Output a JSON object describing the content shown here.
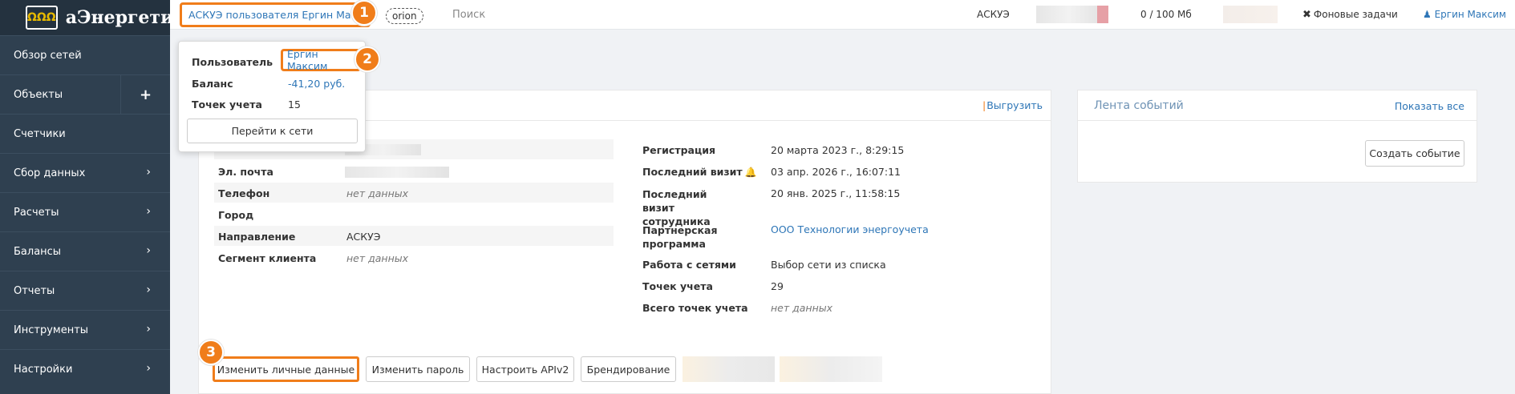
{
  "app": {
    "logo_mark": "ΩΩΩ",
    "logo_text": "аЭнергетик"
  },
  "sidebar": {
    "items": [
      {
        "label": "Обзор сетей",
        "icon": ""
      },
      {
        "label": "Объекты",
        "icon": "plus-icon"
      },
      {
        "label": "Счетчики",
        "icon": ""
      },
      {
        "label": "Сбор данных",
        "icon": "chevron-right-icon"
      },
      {
        "label": "Расчеты",
        "icon": "chevron-right-icon"
      },
      {
        "label": "Балансы",
        "icon": "chevron-right-icon"
      },
      {
        "label": "Отчеты",
        "icon": "chevron-right-icon"
      },
      {
        "label": "Инструменты",
        "icon": "chevron-right-icon"
      },
      {
        "label": "Настройки",
        "icon": "chevron-right-icon"
      }
    ]
  },
  "topbar": {
    "title": "АСКУЭ пользователя Ергин Максим",
    "org": "orion",
    "search": "Поиск",
    "system": "АСКУЭ",
    "storage": "0 / 100 Мб",
    "tasks": "Фоновые задачи",
    "user": "Ергин Максим"
  },
  "popup": {
    "user_label": "Пользователь",
    "user_value": "Ергин Максим",
    "balance_label": "Баланс",
    "balance_value": "-41,20 руб.",
    "points_label": "Точек учета",
    "points_value": "15",
    "go_button": "Перейти к сети"
  },
  "badges": [
    "1",
    "2",
    "3"
  ],
  "profile": {
    "export": "Выгрузить",
    "left_fields": [
      {
        "label": "Эл. почта",
        "value": ""
      },
      {
        "label": "Телефон",
        "value": "нет данных"
      },
      {
        "label": "Город",
        "value": ""
      },
      {
        "label": "Направление",
        "value": "АСКУЭ"
      },
      {
        "label": "Сегмент клиента",
        "value": "нет данных"
      }
    ],
    "right_fields": [
      {
        "label": "Регистрация",
        "value": "20 марта 2023 г., 8:29:15"
      },
      {
        "label": "Последний визит",
        "value": "03 апр. 2026 г., 16:07:11"
      },
      {
        "label": "Последний визит сотрудника",
        "value": "20 янв. 2025 г., 11:58:15"
      },
      {
        "label": "Партнерская программа",
        "value": "ООО Технологии энергоучета"
      },
      {
        "label": "Работа с сетями",
        "value": "Выбор сети из списка"
      },
      {
        "label": "Точек учета",
        "value": "29"
      },
      {
        "label": "Всего точек учета",
        "value": "нет данных"
      }
    ],
    "buttons": {
      "edit_personal": "Изменить личные данные",
      "change_password": "Изменить пароль",
      "setup_api": "Настроить APIv2",
      "branding": "Брендирование"
    }
  },
  "events": {
    "title": "Лента событий",
    "show_all": "Показать все",
    "create": "Создать событие"
  },
  "colors": {
    "accent": "#f07d1a",
    "link": "#2e76b7",
    "sidebar": "#2f4050"
  }
}
